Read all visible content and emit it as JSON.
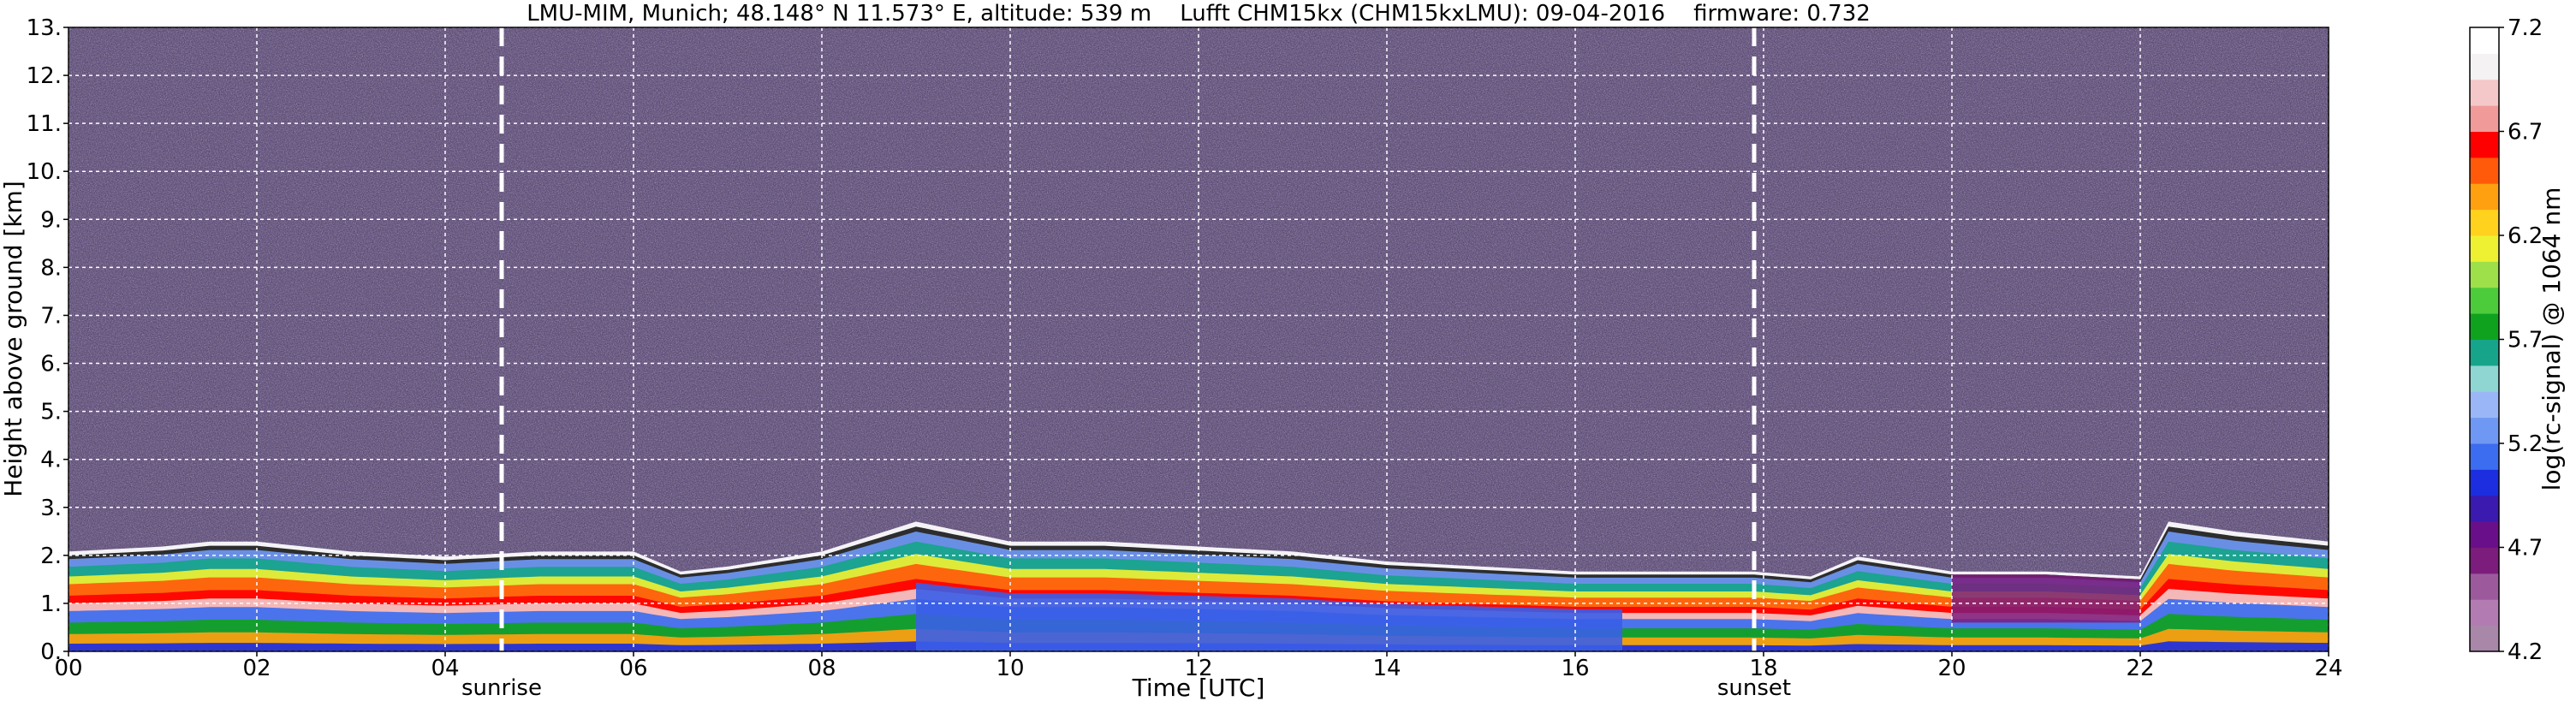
{
  "chart_data": {
    "type": "heatmap",
    "title": "LMU-MIM, Munich; 48.148° N 11.573° E, altitude: 539 m    Lufft CHM15kx (CHM15kxLMU): 09-04-2016    firmware: 0.732",
    "xlabel": "Time [UTC]",
    "ylabel": "Height above ground [km]",
    "xlim": [
      0,
      24
    ],
    "ylim": [
      0,
      13
    ],
    "x_ticks": [
      0,
      2,
      4,
      6,
      8,
      10,
      12,
      14,
      16,
      18,
      20,
      22,
      24
    ],
    "x_tick_labels": [
      "00",
      "02",
      "04",
      "06",
      "08",
      "10",
      "12",
      "14",
      "16",
      "18",
      "20",
      "22",
      "24"
    ],
    "y_ticks": [
      0,
      1,
      2,
      3,
      4,
      5,
      6,
      7,
      8,
      9,
      10,
      11,
      12,
      13
    ],
    "y_tick_labels": [
      "0.",
      "1.",
      "2.",
      "3.",
      "4.",
      "5.",
      "6.",
      "7.",
      "8.",
      "9.",
      "10.",
      "11.",
      "12.",
      "13."
    ],
    "grid": true,
    "events": [
      {
        "label": "sunrise",
        "x": 4.6
      },
      {
        "label": "sunset",
        "x": 17.9
      }
    ],
    "colorbar": {
      "label": "log(rc-signal) @ 1064 nm",
      "range": [
        4.2,
        7.2
      ],
      "ticks": [
        4.2,
        4.7,
        5.2,
        5.7,
        6.2,
        6.7,
        7.2
      ],
      "tick_labels": [
        "4.2",
        "4.7",
        "5.2",
        "5.7",
        "6.2",
        "6.7",
        "7.2"
      ],
      "colors": [
        "#a887a8",
        "#b27cb2",
        "#9c5a9c",
        "#7c1c7c",
        "#6a0f8a",
        "#3a1aaf",
        "#1c2ee0",
        "#3c6df0",
        "#6f98f4",
        "#9bb6f6",
        "#8fd6d3",
        "#16a58a",
        "#0fa21e",
        "#4ccc3a",
        "#9ee04a",
        "#eef032",
        "#ffd21e",
        "#ffa010",
        "#ff5a0a",
        "#ff0000",
        "#f09a9a",
        "#f4c8c8",
        "#f4f2f2",
        "#ffffff"
      ]
    },
    "boundary_layer_top_km": {
      "time_h": [
        0,
        1,
        1.5,
        2,
        3,
        4,
        5,
        6,
        6.5,
        7,
        8,
        8.5,
        9,
        10,
        11,
        12,
        13,
        14,
        15,
        16,
        17,
        17.9,
        18.5,
        19,
        20,
        21,
        22,
        22.3,
        23,
        24
      ],
      "height_km": [
        2.0,
        2.1,
        2.2,
        2.2,
        2.0,
        1.9,
        2.0,
        2.0,
        1.6,
        1.7,
        2.0,
        2.3,
        2.6,
        2.2,
        2.2,
        2.1,
        2.0,
        1.8,
        1.7,
        1.6,
        1.6,
        1.6,
        1.5,
        1.9,
        1.6,
        1.6,
        1.5,
        2.6,
        2.4,
        2.2
      ]
    }
  }
}
